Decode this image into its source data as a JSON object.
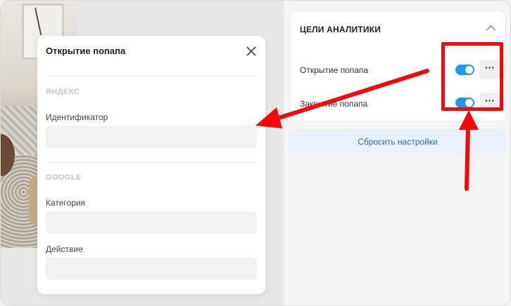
{
  "analytics_panel": {
    "title": "ЦЕЛИ АНАЛИТИКИ",
    "goals": [
      {
        "label": "Открытие попапа",
        "enabled": true,
        "more": "···"
      },
      {
        "label": "Закрытие попапа",
        "enabled": true,
        "more": "···"
      }
    ],
    "reset_label": "Сбросить настройки"
  },
  "popup": {
    "title": "Открытие попапа",
    "yandex": {
      "heading": "ЯНДЕКС",
      "identifier_label": "Идентификатор",
      "identifier_value": ""
    },
    "google": {
      "heading": "GOOGLE",
      "category_label": "Категория",
      "category_value": "",
      "action_label": "Действие",
      "action_value": ""
    }
  },
  "colors": {
    "toggle_on": "#1a9af0",
    "highlight": "#f00a0a",
    "reset_text": "#2b6cb0"
  }
}
